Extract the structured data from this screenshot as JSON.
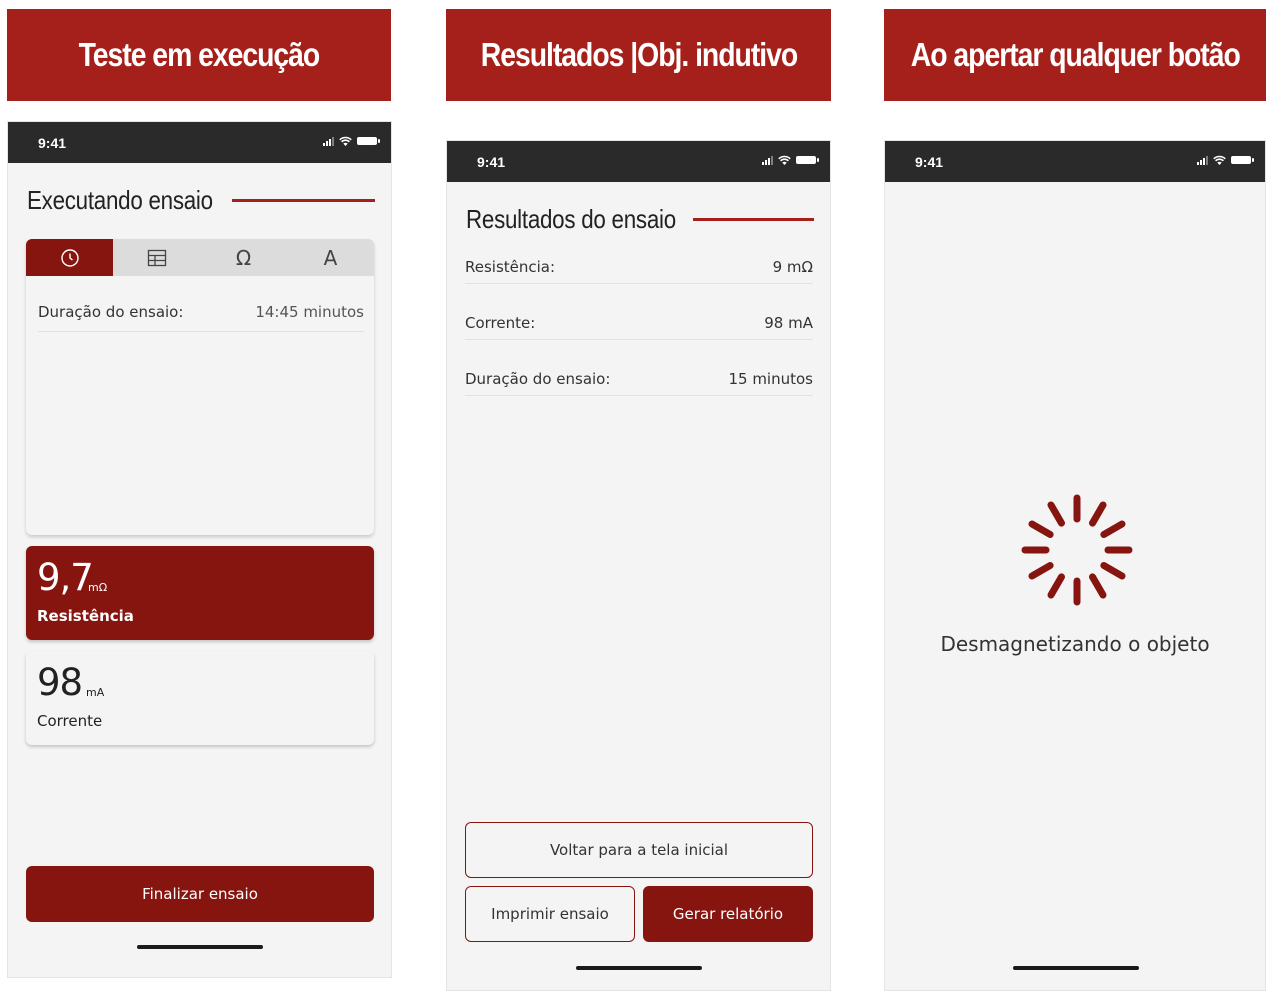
{
  "banners": [
    "Teste em execução",
    "Resultados |Obj. indutivo",
    "Ao apertar qualquer botão"
  ],
  "status_bar": {
    "time": "9:41"
  },
  "screen_running": {
    "title": "Executando ensaio",
    "tabs": [
      "clock-icon",
      "table-icon",
      "Ω",
      "A"
    ],
    "active_tab": 0,
    "duration_label": "Duração do ensaio:",
    "duration_value": "14:45 minutos",
    "resistance": {
      "value": "9,7",
      "unit": "mΩ",
      "label": "Resistência"
    },
    "current": {
      "value": "98",
      "unit": "mA",
      "label": "Corrente"
    },
    "finish_button": "Finalizar ensaio"
  },
  "screen_results": {
    "title": "Resultados do ensaio",
    "rows": [
      {
        "label": "Resistência:",
        "value": "9 mΩ"
      },
      {
        "label": "Corrente:",
        "value": "98 mA"
      },
      {
        "label": "Duração do ensaio:",
        "value": "15 minutos"
      }
    ],
    "back_button": "Voltar para a tela inicial",
    "print_button": "Imprimir ensaio",
    "report_button": "Gerar relatório"
  },
  "screen_loading": {
    "message": "Desmagnetizando o objeto"
  },
  "colors": {
    "brand": "#a5201a",
    "dark_red": "#861510",
    "status_bar": "#2a2a2a"
  }
}
